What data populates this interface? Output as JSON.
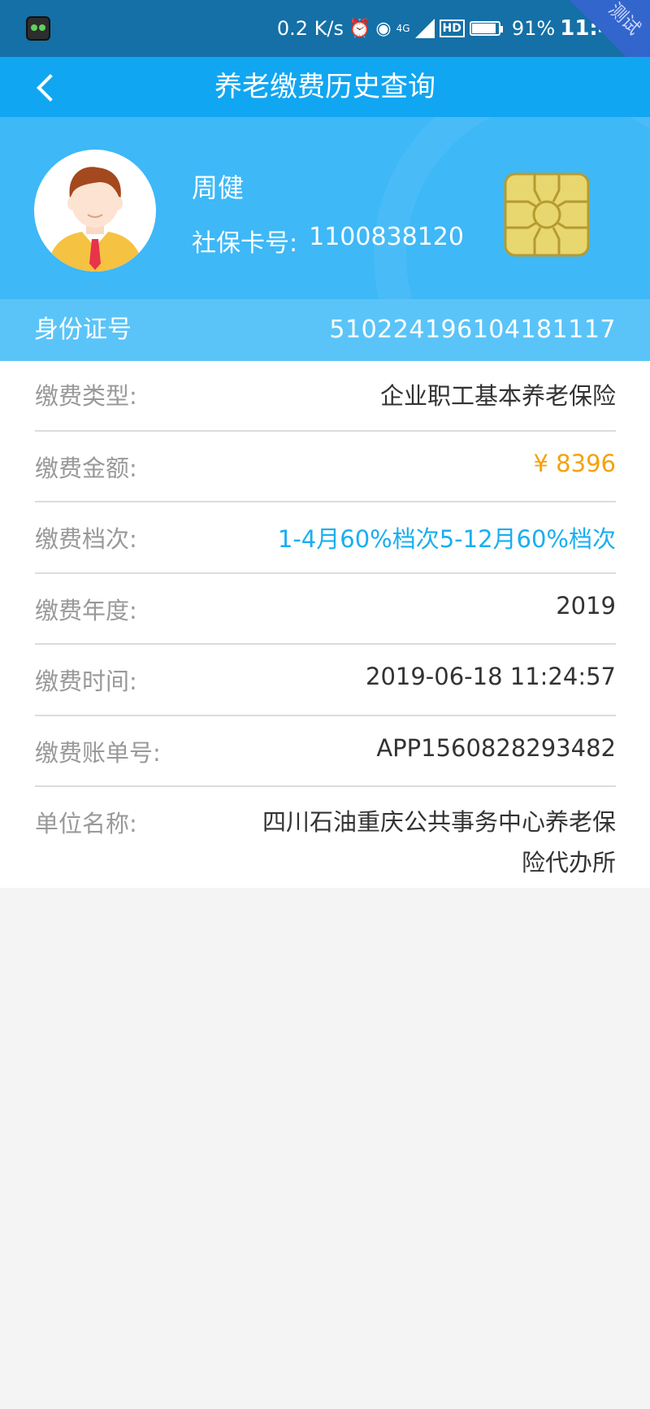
{
  "status_bar": {
    "network_speed": "0.2 K/s",
    "network_type": "4G",
    "hd_label": "HD",
    "battery": "91%",
    "time": "11:44",
    "corner_badge": "测试"
  },
  "header": {
    "title": "养老缴费历史查询"
  },
  "profile": {
    "name": "周健",
    "card_label": "社保卡号:",
    "card_number": "1100838120"
  },
  "id_bar": {
    "label": "身份证号",
    "value": "510224196104181117"
  },
  "details": [
    {
      "label": "缴费类型:",
      "value": "企业职工基本养老保险"
    },
    {
      "label": "缴费金额:",
      "value": "¥ 8396"
    },
    {
      "label": "缴费档次:",
      "value": "1-4月60%档次5-12月60%档次"
    },
    {
      "label": "缴费年度:",
      "value": "2019"
    },
    {
      "label": "缴费时间:",
      "value": "2019-06-18 11:24:57"
    },
    {
      "label": "缴费账单号:",
      "value": "APP1560828293482"
    },
    {
      "label": "单位名称:",
      "value_line1": "四川石油重庆公共事务中心养老保",
      "value_line2": "险代办所"
    }
  ],
  "colors": {
    "status_bar": "#1470a6",
    "nav_bar": "#11a6f2",
    "profile_bg": "#3eb8f7",
    "id_bar": "#5ac4f8",
    "amount": "#f5a20a",
    "level": "#1aaef0"
  },
  "icons": [
    "app-notification-icon",
    "alarm-icon",
    "hotspot-icon",
    "signal-icon",
    "battery-icon",
    "back-arrow-icon",
    "avatar-icon",
    "chip-icon"
  ]
}
